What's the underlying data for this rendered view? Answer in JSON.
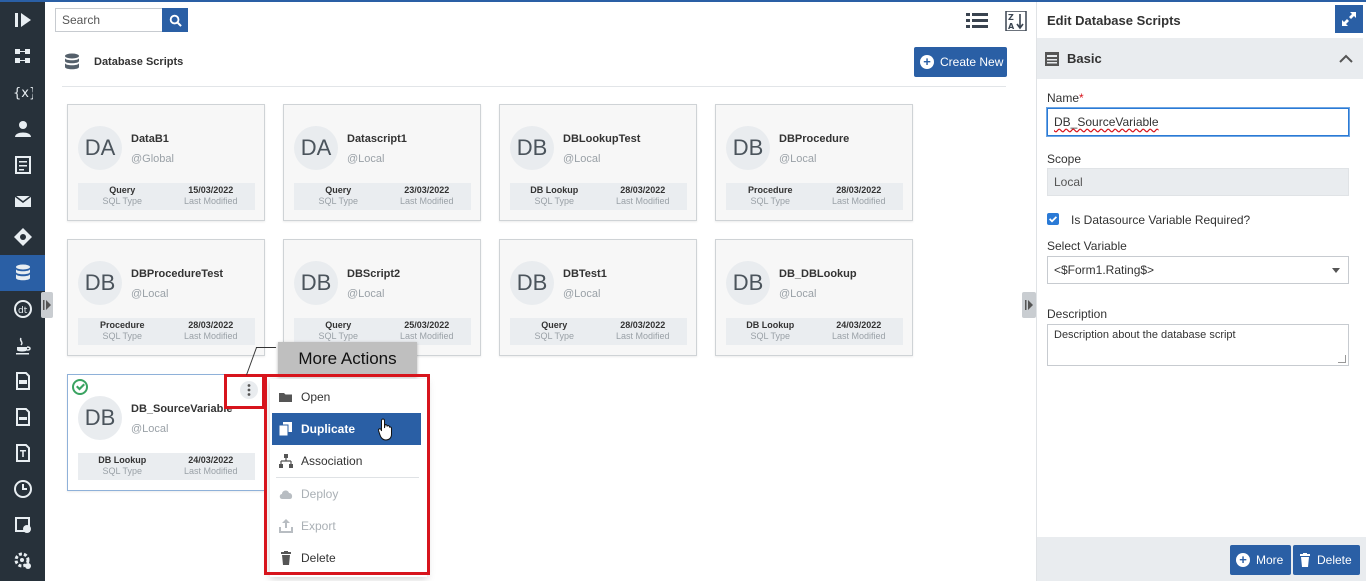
{
  "search": {
    "placeholder": "Search"
  },
  "header": {
    "title": "Database Scripts",
    "create_label": "Create New"
  },
  "cards": [
    {
      "initials": "DA",
      "name": "DataB1",
      "scope": "@Global",
      "type": "Query",
      "type_label": "SQL Type",
      "date": "15/03/2022",
      "date_label": "Last Modified"
    },
    {
      "initials": "DA",
      "name": "Datascript1",
      "scope": "@Local",
      "type": "Query",
      "type_label": "SQL Type",
      "date": "23/03/2022",
      "date_label": "Last Modified"
    },
    {
      "initials": "DB",
      "name": "DBLookupTest",
      "scope": "@Local",
      "type": "DB Lookup",
      "type_label": "SQL Type",
      "date": "28/03/2022",
      "date_label": "Last Modified"
    },
    {
      "initials": "DB",
      "name": "DBProcedure",
      "scope": "@Local",
      "type": "Procedure",
      "type_label": "SQL Type",
      "date": "28/03/2022",
      "date_label": "Last Modified"
    },
    {
      "initials": "DB",
      "name": "DBProcedureTest",
      "scope": "@Local",
      "type": "Procedure",
      "type_label": "SQL Type",
      "date": "28/03/2022",
      "date_label": "Last Modified"
    },
    {
      "initials": "DB",
      "name": "DBScript2",
      "scope": "@Local",
      "type": "Query",
      "type_label": "SQL Type",
      "date": "25/03/2022",
      "date_label": "Last Modified"
    },
    {
      "initials": "DB",
      "name": "DBTest1",
      "scope": "@Local",
      "type": "Query",
      "type_label": "SQL Type",
      "date": "28/03/2022",
      "date_label": "Last Modified"
    },
    {
      "initials": "DB",
      "name": "DB_DBLookup",
      "scope": "@Local",
      "type": "DB Lookup",
      "type_label": "SQL Type",
      "date": "24/03/2022",
      "date_label": "Last Modified"
    },
    {
      "initials": "DB",
      "name": "DB_SourceVariable",
      "scope": "@Local",
      "type": "DB Lookup",
      "type_label": "SQL Type",
      "date": "24/03/2022",
      "date_label": "Last Modified"
    }
  ],
  "tooltip": "More Actions",
  "menu": {
    "open": "Open",
    "duplicate": "Duplicate",
    "association": "Association",
    "deploy": "Deploy",
    "export": "Export",
    "delete": "Delete"
  },
  "panel": {
    "title": "Edit Database Scripts",
    "section": "Basic",
    "name_label": "Name",
    "required_mark": "*",
    "name_value": "DB_SourceVariable",
    "scope_label": "Scope",
    "scope_value": "Local",
    "datasource_label": "Is Datasource Variable Required?",
    "datasource_checked": true,
    "select_label": "Select Variable",
    "select_value": "<$Form1.Rating$>",
    "description_label": "Description",
    "description_value": "Description about the database script",
    "more_label": "More",
    "delete_label": "Delete"
  },
  "colors": {
    "accent": "#2a5fa5",
    "rail": "#27313a",
    "highlight": "#d7141c",
    "success": "#3aa361"
  },
  "icons": {
    "rail": [
      "logo-icon",
      "flow-icon",
      "variables-icon",
      "user-icon",
      "form-icon",
      "mail-icon",
      "decision-icon",
      "database-icon",
      "api-icon",
      "java-icon",
      "file-icon",
      "sheet-icon",
      "template-icon",
      "clock-icon",
      "report-icon",
      "settings-icon"
    ]
  }
}
